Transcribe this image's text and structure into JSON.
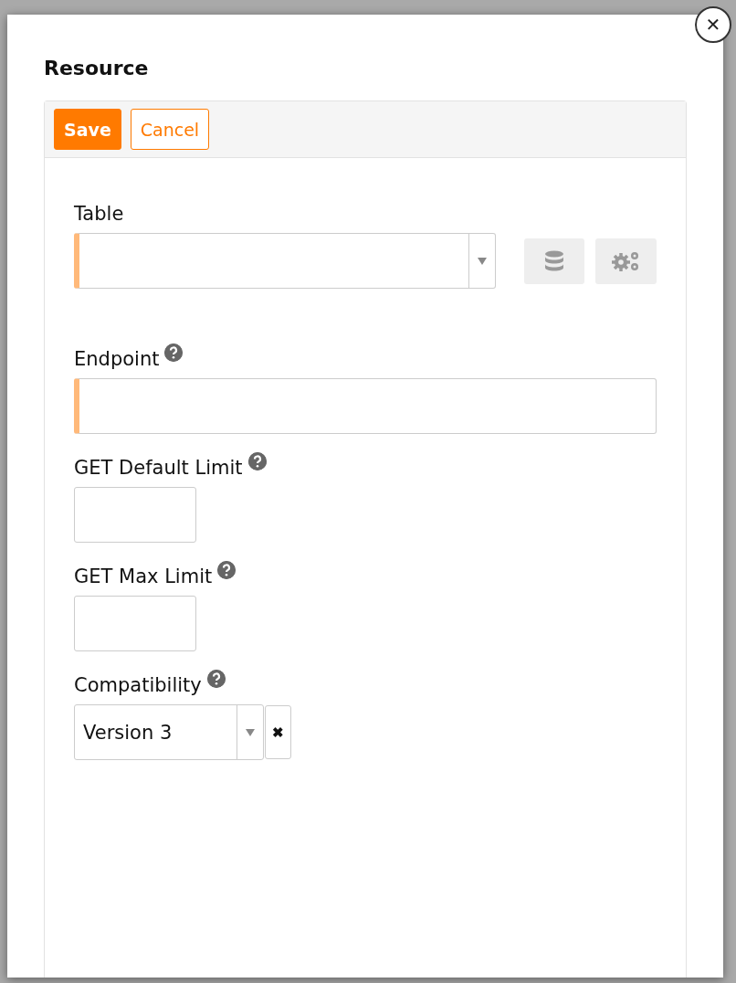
{
  "dialog": {
    "title": "Resource",
    "close": "✕"
  },
  "toolbar": {
    "buttons": [
      {
        "label": "Save",
        "kind": "primary"
      },
      {
        "label": "Cancel",
        "kind": "secondary"
      }
    ]
  },
  "fields": [
    {
      "label": "Table",
      "kind": "select",
      "required": true,
      "help": false,
      "actions": [
        {
          "kind": "database"
        },
        {
          "kind": "gears"
        }
      ]
    },
    {
      "label": "Endpoint",
      "kind": "text",
      "required": true,
      "help": true
    },
    {
      "label": "GET Default Limit",
      "kind": "number",
      "required": false,
      "help": true
    },
    {
      "label": "GET Max Limit",
      "kind": "number",
      "required": false,
      "help": true
    },
    {
      "label": "Compatibility",
      "kind": "clearable-select",
      "required": false,
      "help": true,
      "value": "Version 3",
      "clear": "✖"
    }
  ]
}
